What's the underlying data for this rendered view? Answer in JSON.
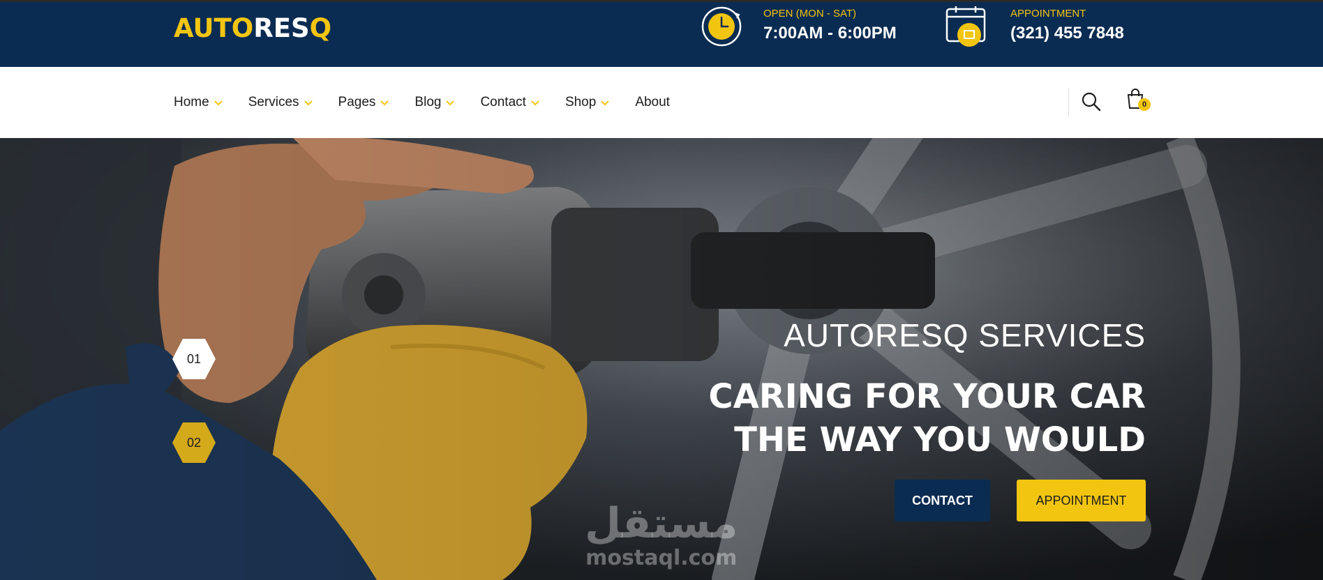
{
  "brand": {
    "logo_part1": "AUTO",
    "logo_part2": "RES",
    "logo_part3": "Q",
    "accent_color": "#f2c511",
    "navy_color": "#0b2c52"
  },
  "topbar": {
    "hours": {
      "icon": "clock-icon",
      "label": "OPEN (MON - SAT)",
      "value": "7:00AM - 6:00PM"
    },
    "appointment": {
      "icon": "calendar-icon",
      "label": "APPOINTMENT",
      "value": "(321) 455 7848"
    }
  },
  "nav": {
    "items": [
      {
        "label": "Home",
        "has_dropdown": true
      },
      {
        "label": "Services",
        "has_dropdown": true
      },
      {
        "label": "Pages",
        "has_dropdown": true
      },
      {
        "label": "Blog",
        "has_dropdown": true
      },
      {
        "label": "Contact",
        "has_dropdown": true
      },
      {
        "label": "Shop",
        "has_dropdown": true
      },
      {
        "label": "About",
        "has_dropdown": false
      }
    ],
    "search_icon": "search-icon",
    "cart_icon": "shopping-bag-icon",
    "cart_count": "0"
  },
  "hero": {
    "subtitle": "AUTORESQ SERVICES",
    "title_line1": "CARING FOR YOUR CAR",
    "title_line2": "THE WAY YOU WOULD",
    "contact_button": "CONTACT",
    "appointment_button": "APPOINTMENT",
    "slides": [
      "01",
      "02"
    ],
    "active_slide": "02"
  },
  "watermark": {
    "arabic": "مستقل",
    "latin": "mostaql.com"
  }
}
